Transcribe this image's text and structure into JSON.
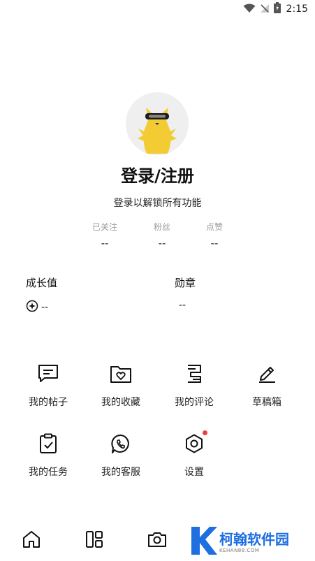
{
  "status_bar": {
    "time": "2:15"
  },
  "profile": {
    "title": "登录/注册",
    "subtitle": "登录以解锁所有功能"
  },
  "stats": [
    {
      "label": "已关注",
      "value": "--"
    },
    {
      "label": "粉丝",
      "value": "--"
    },
    {
      "label": "点赞",
      "value": "--"
    }
  ],
  "growth": {
    "label": "成长值",
    "value": "--"
  },
  "medals": {
    "label": "勋章",
    "value": "--"
  },
  "menu": [
    {
      "label": "我的帖子",
      "icon": "posts-icon"
    },
    {
      "label": "我的收藏",
      "icon": "favorites-folder-icon"
    },
    {
      "label": "我的评论",
      "icon": "comments-icon"
    },
    {
      "label": "草稿箱",
      "icon": "pencil-icon"
    },
    {
      "label": "我的任务",
      "icon": "tasks-clipboard-icon"
    },
    {
      "label": "我的客服",
      "icon": "phone-chat-icon"
    },
    {
      "label": "设置",
      "icon": "settings-hexagon-icon",
      "badge": true
    }
  ],
  "bottom_nav": [
    {
      "icon": "home-icon"
    },
    {
      "icon": "layout-icon"
    },
    {
      "icon": "camera-icon"
    }
  ],
  "watermark": {
    "name": "柯翰软件园",
    "domain": "KEHAN88.COM"
  },
  "colors": {
    "badge": "#e8423a",
    "watermark_blue": "#1e6fe0",
    "text": "#111111",
    "muted": "#9a9a9a",
    "avatar_yellow": "#f2cc32"
  }
}
